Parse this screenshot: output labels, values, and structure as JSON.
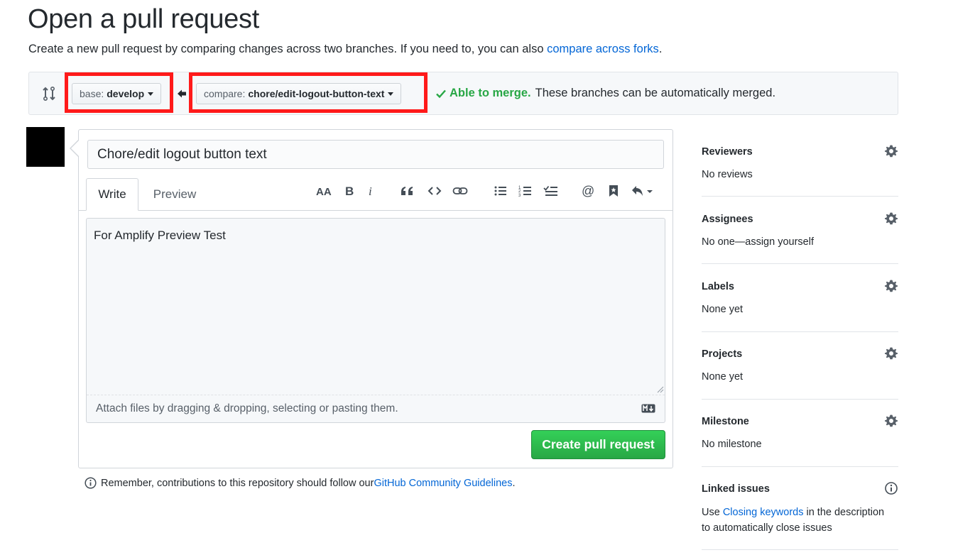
{
  "header": {
    "title": "Open a pull request",
    "subtitle_text": "Create a new pull request by comparing changes across two branches. If you need to, you can also ",
    "subtitle_link": "compare across forks",
    "subtitle_end": "."
  },
  "range": {
    "base_label": "base:",
    "base_branch": "develop",
    "compare_label": "compare:",
    "compare_branch": "chore/edit-logout-button-text",
    "merge_ok": "Able to merge.",
    "merge_text": "These branches can be automatically merged."
  },
  "form": {
    "title_value": "Chore/edit logout button text",
    "tabs": [
      "Write",
      "Preview"
    ],
    "body_value": "For Amplify Preview Test",
    "attach_text": "Attach files by dragging & dropping, selecting or pasting them.",
    "submit_label": "Create pull request"
  },
  "toolbar": {
    "icons": [
      "text-size-icon",
      "bold-icon",
      "italic-icon",
      "quote-icon",
      "code-icon",
      "link-icon",
      "unordered-list-icon",
      "ordered-list-icon",
      "task-list-icon",
      "mention-icon",
      "reference-icon",
      "reply-icon"
    ]
  },
  "footer": {
    "remember_text": "Remember, contributions to this repository should follow our ",
    "guidelines_link": "GitHub Community Guidelines",
    "end": "."
  },
  "sidebar": {
    "reviewers": {
      "title": "Reviewers",
      "value": "No reviews"
    },
    "assignees": {
      "title": "Assignees",
      "value": "No one—assign yourself"
    },
    "labels": {
      "title": "Labels",
      "value": "None yet"
    },
    "projects": {
      "title": "Projects",
      "value": "None yet"
    },
    "milestone": {
      "title": "Milestone",
      "value": "No milestone"
    },
    "linked_issues": {
      "title": "Linked issues",
      "value_pre": "Use ",
      "value_link": "Closing keywords",
      "value_post": " in the description",
      "value_line2": "to automatically close issues"
    }
  },
  "colors": {
    "link": "#0366d6",
    "success": "#28a745",
    "highlight": "#ff1a1a"
  }
}
